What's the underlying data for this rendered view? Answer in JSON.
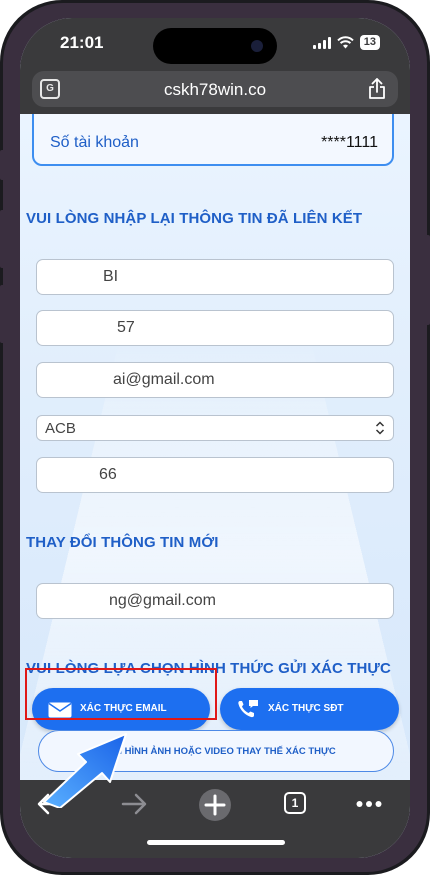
{
  "status_bar": {
    "time": "21:01",
    "battery": "13"
  },
  "browser": {
    "url": "cskh78win.co"
  },
  "account_card": {
    "label": "Số tài khoản",
    "value": "****1111"
  },
  "sections": {
    "relink_title": "VUI LÒNG NHẬP LẠI THÔNG TIN ĐÃ LIÊN KẾT",
    "new_info_title": "THAY ĐỔI THÔNG TIN MỚI",
    "verify_method_title": "VUI LÒNG LỰA CHỌN HÌNH THỨC GỬI XÁC THỰC"
  },
  "relink_fields": {
    "name": "BI",
    "phone": "57",
    "email": "ai@gmail.com",
    "bank": "ACB",
    "account_number": "66"
  },
  "new_info_fields": {
    "email": "ng@gmail.com"
  },
  "buttons": {
    "verify_email": "XÁC THỰC EMAIL",
    "verify_sdt": "XÁC THỰC SĐT",
    "upload_media": "LÊN HÌNH ẢNH HOẶC VIDEO THAY THẾ XÁC THỰC"
  },
  "toolbar": {
    "tab_count": "1"
  },
  "colors": {
    "accent": "#1d6ff0",
    "highlight": "#e01818",
    "title": "#1f5fc7"
  },
  "icons": {
    "status": [
      "signal-icon",
      "wifi-icon",
      "battery-icon"
    ],
    "address_bar": [
      "translate-icon",
      "share-icon"
    ],
    "toolbar": [
      "back-icon",
      "forward-icon",
      "new-tab-icon",
      "tabs-icon",
      "more-icon"
    ]
  }
}
